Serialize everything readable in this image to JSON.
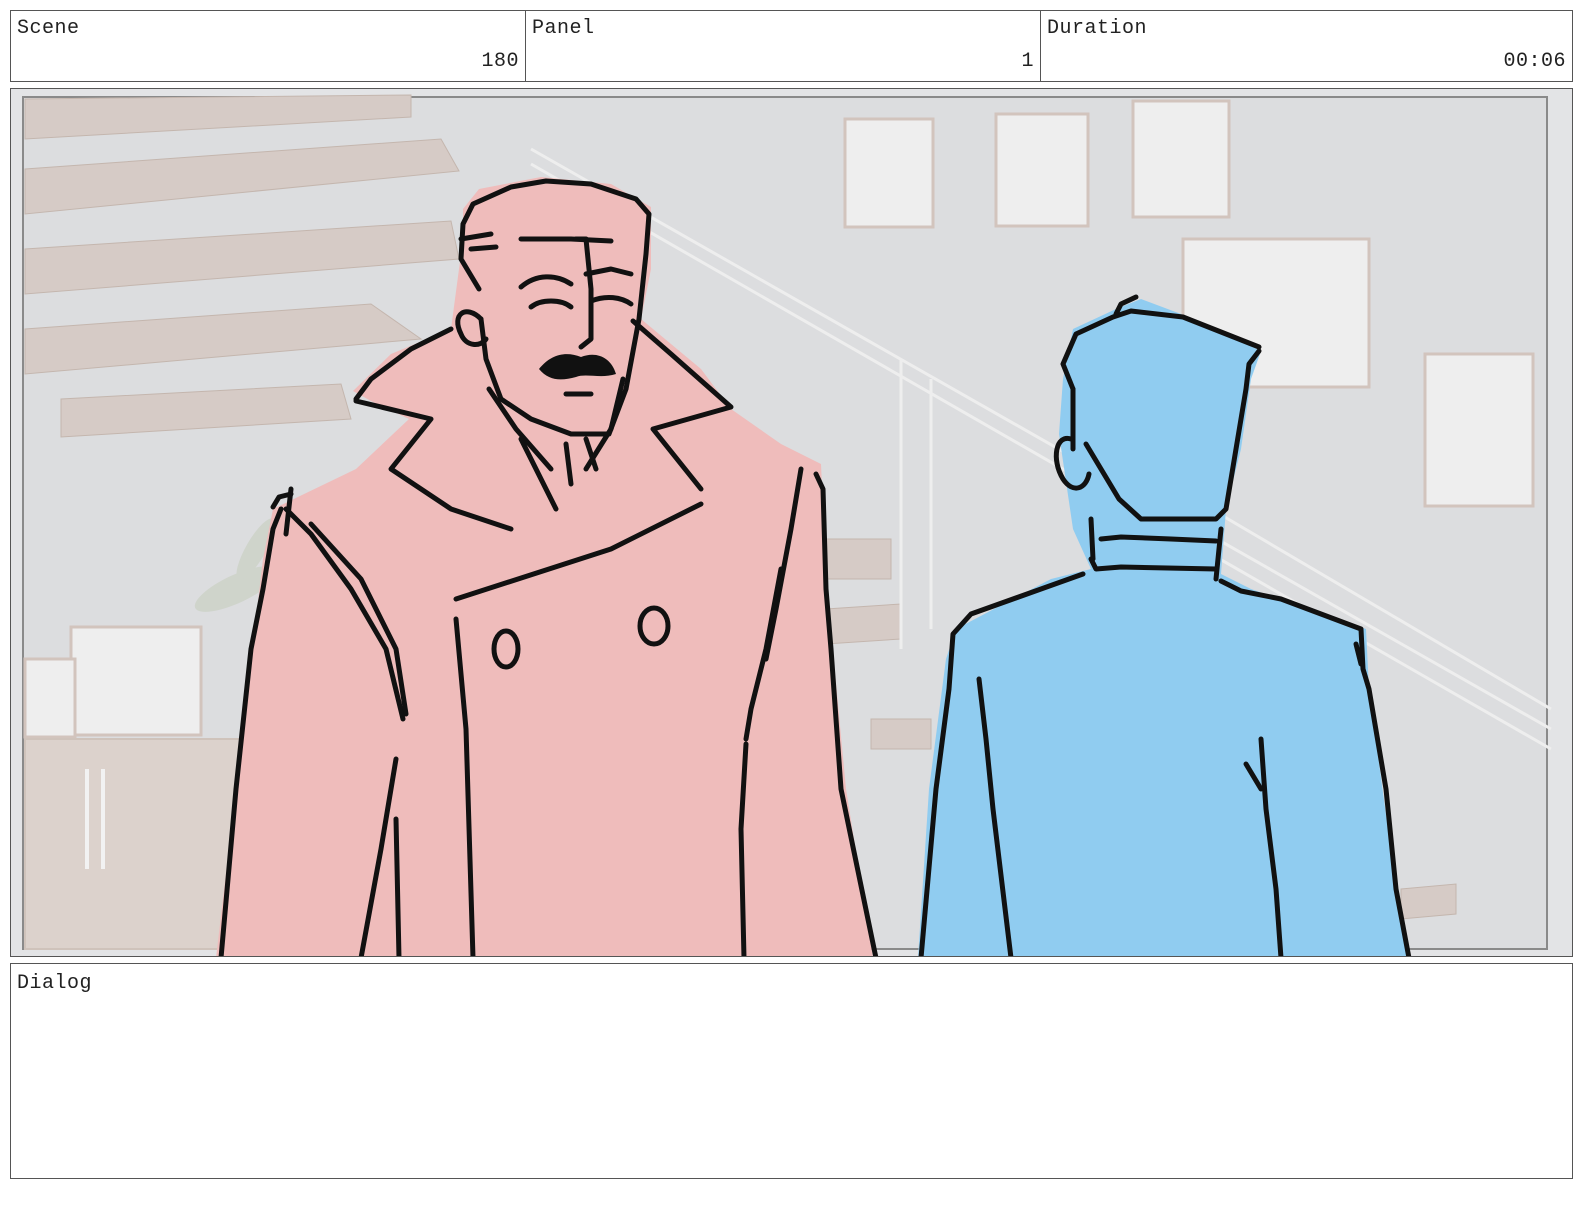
{
  "header": {
    "scene_label": "Scene",
    "scene_value": "180",
    "panel_label": "Panel",
    "panel_value": "1",
    "duration_label": "Duration",
    "duration_value": "00:06"
  },
  "dialog": {
    "label": "Dialog",
    "text": ""
  },
  "colors": {
    "border": "#555555",
    "background_wall": "#dedfe1",
    "character_left_fill": "#efbcbb",
    "character_right_fill": "#90ccf0",
    "ink": "#111111"
  }
}
